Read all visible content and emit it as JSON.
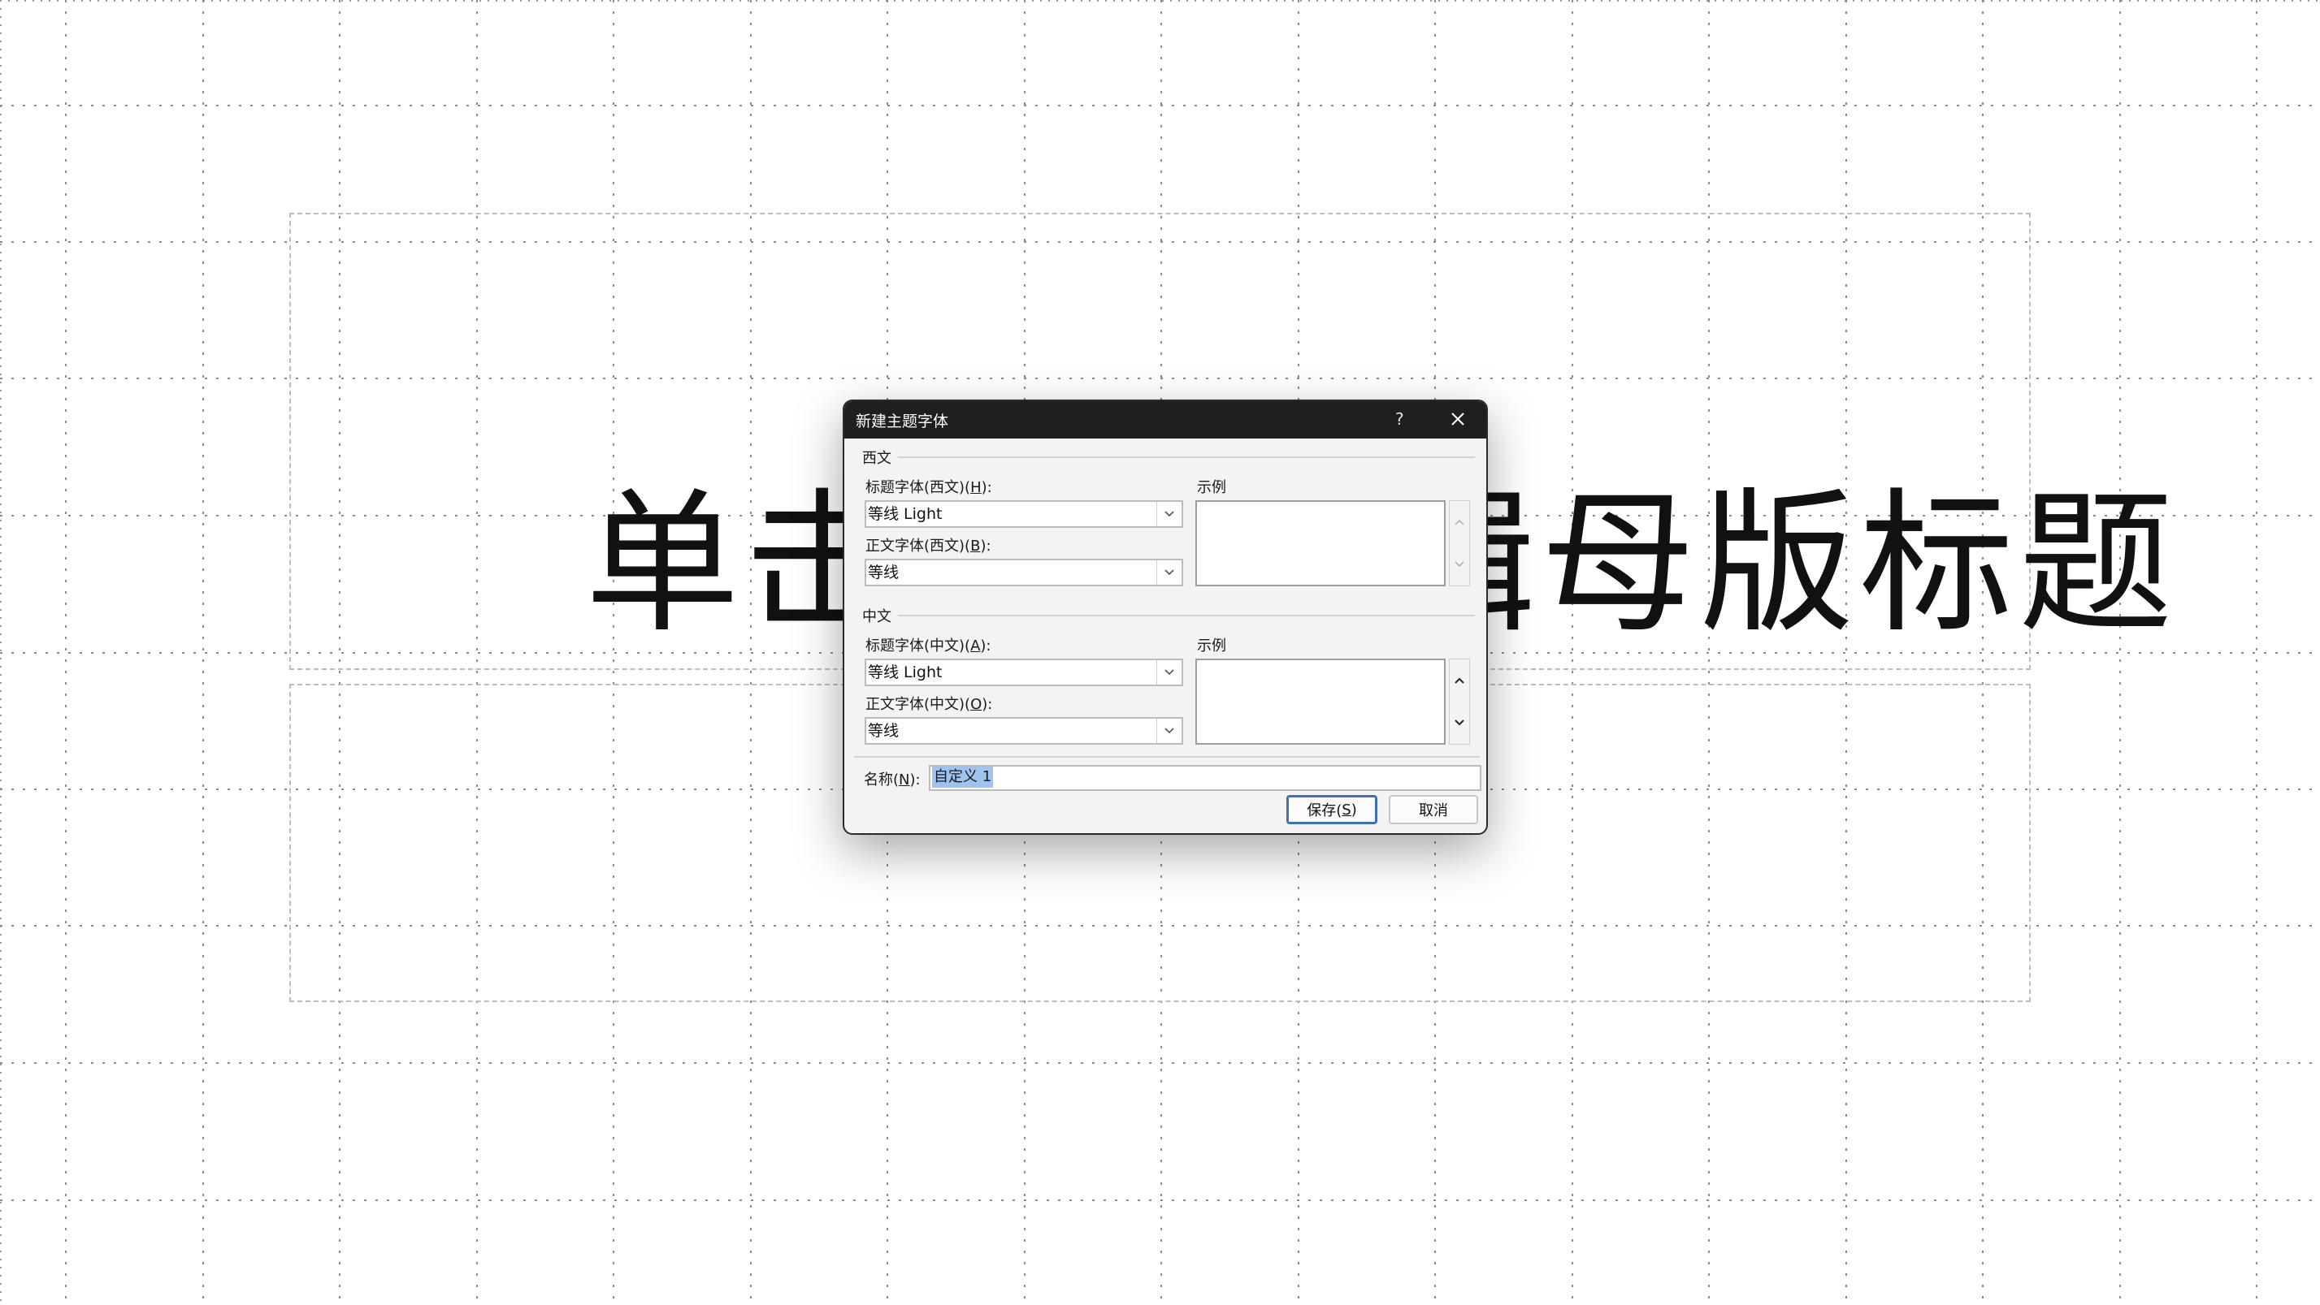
{
  "slide": {
    "title_text": "单击此处编辑母版标题"
  },
  "dialog": {
    "title": "新建主题字体",
    "help_label": "?",
    "western": {
      "group_label": "西文",
      "heading_label": "标题字体(西文)(",
      "heading_key": "H",
      "heading_value": "等线 Light",
      "body_label": "正文字体(西文)(",
      "body_key": "B",
      "body_value": "等线",
      "sample_label": "示例"
    },
    "chinese": {
      "group_label": "中文",
      "heading_label": "标题字体(中文)(",
      "heading_key": "A",
      "heading_value": "等线 Light",
      "body_label": "正文字体(中文)(",
      "body_key": "O",
      "body_value": "等线",
      "sample_label": "示例"
    },
    "name_label": "名称(",
    "name_key": "N",
    "name_value": "自定义 1",
    "save_label": "保存(",
    "save_key": "S",
    "cancel_label": "取消"
  }
}
